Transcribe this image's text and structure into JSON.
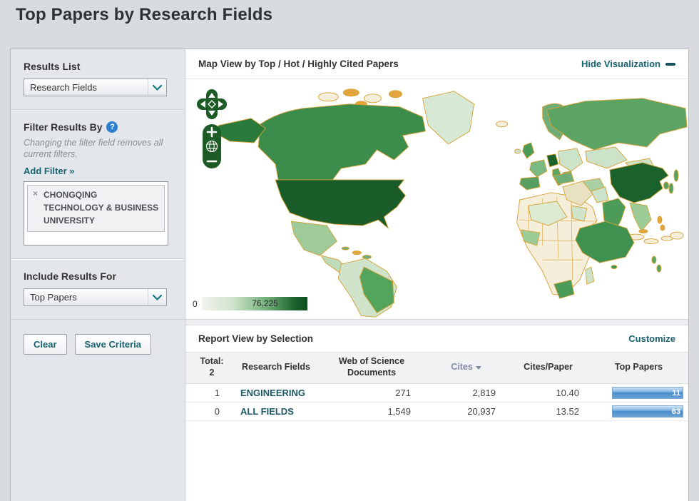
{
  "page": {
    "title": "Top Papers by Research Fields"
  },
  "sidebar": {
    "results_list_heading": "Results List",
    "results_list_selected": "Research Fields",
    "filter_heading": "Filter Results By",
    "filter_help": "?",
    "filter_note": "Changing the filter field removes all current filters.",
    "add_filter": "Add Filter »",
    "filter_chip": {
      "remove": "×",
      "label": "CHONGQING TECHNOLOGY & BUSINESS UNIVERSITY"
    },
    "include_heading": "Include Results For",
    "include_selected": "Top Papers",
    "clear_button": "Clear",
    "save_button": "Save Criteria"
  },
  "map": {
    "header": "Map View by Top / Hot / Highly Cited Papers",
    "hide_link": "Hide Visualization",
    "controls": {
      "zoom_in": "+",
      "zoom_out": "−"
    },
    "legend_min": "0",
    "legend_max": "76,225"
  },
  "report": {
    "header": "Report View by Selection",
    "customize": "Customize",
    "table": {
      "total_label": "Total:",
      "total_value": "2",
      "col_field": "Research Fields",
      "col_docs": "Web of Science Documents",
      "col_cites": "Cites",
      "col_cpp": "Cites/Paper",
      "col_top": "Top Papers",
      "rows": [
        {
          "rank": "1",
          "field": "ENGINEERING",
          "docs": "271",
          "cites": "2,819",
          "cpp": "10.40",
          "top": "11"
        },
        {
          "rank": "0",
          "field": "ALL FIELDS",
          "docs": "1,549",
          "cites": "20,937",
          "cpp": "13.52",
          "top": "63"
        }
      ]
    }
  },
  "colors": {
    "accent_teal": "#186370",
    "map_dark_green": "#1b612c",
    "map_mid_green": "#53a05d",
    "map_pale_green": "#cde3c9",
    "map_no_data_cream": "#f4eeda",
    "map_border_orange": "#d7a033",
    "bar_blue": "#4a8ecb",
    "cites_header_blue": "#7e8aa6",
    "help_badge_blue": "#2f7fd0"
  }
}
